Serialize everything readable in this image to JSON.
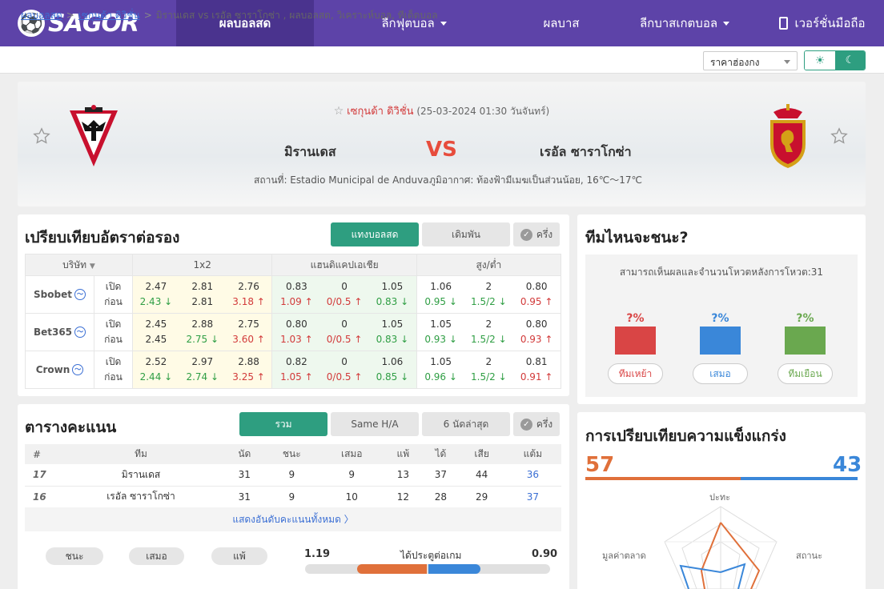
{
  "nav": {
    "logo": "SAGOR",
    "items": [
      {
        "label": "ผลบอลสด",
        "active": true
      },
      {
        "label": "ลีกฟุตบอล",
        "caret": true
      },
      {
        "label": "ผลบาส"
      },
      {
        "label": "ลีกบาสเกตบอล",
        "caret": true
      },
      {
        "label": "เวอร์ชั่นมือถือ"
      }
    ]
  },
  "breadcrumb": {
    "home": "ผลบอลสด",
    "league": "เซกุนด้า ดิวิชั่น",
    "rest": "มิรานเดส vs  เรอัล ซาราโกซ่า ,  ผลบอลสด,  วิเคราะห์บอล,  ทีเด็ดบอล"
  },
  "odds_select": "ราคาฮ่องกง",
  "match": {
    "league": "เซกุนด้า ดิวิชั่น",
    "datetime": "(25-03-2024 01:30 วันจันทร์)",
    "home": "มิรานเดส",
    "away": "เรอัล ซาราโกซ่า",
    "vs": "VS",
    "venue": "สถานที่: Estadio Municipal de Anduva",
    "weather": "ภูมิอากาศ: ท้องฟ้ามีเมฆเป็นส่วนน้อย, 16℃～17℃"
  },
  "odds": {
    "title": "เปรียบเทียบอัตราต่อรอง",
    "tabs": [
      "แทงบอลสด",
      "เดิมพัน"
    ],
    "half": "ครึ่ง",
    "head": {
      "company": "บริษัท",
      "x12": "1x2",
      "ah": "แฮนดิแคปเอเชีย",
      "ou": "สูง/ต่ำ"
    },
    "open_label": "เปิด",
    "before_label": "ก่อน",
    "rows": [
      {
        "company": "Sbobet",
        "open": [
          "2.47",
          "2.81",
          "2.76",
          "0.83",
          "0",
          "1.05",
          "1.06",
          "2",
          "0.80"
        ],
        "before": [
          "2.43 ↓",
          "2.81",
          "3.18 ↑",
          "1.09 ↑",
          "0/0.5 ↑",
          "0.83 ↓",
          "0.95 ↓",
          "1.5/2 ↓",
          "0.95 ↑"
        ],
        "dirs": [
          "dn",
          "",
          "up",
          "up",
          "up",
          "dn",
          "dn",
          "dn",
          "up"
        ]
      },
      {
        "company": "Bet365",
        "open": [
          "2.45",
          "2.88",
          "2.75",
          "0.80",
          "0",
          "1.05",
          "1.05",
          "2",
          "0.80"
        ],
        "before": [
          "2.45",
          "2.75 ↓",
          "3.60 ↑",
          "1.03 ↑",
          "0/0.5 ↑",
          "0.83 ↓",
          "0.93 ↓",
          "1.5/2 ↓",
          "0.93 ↑"
        ],
        "dirs": [
          "",
          "dn",
          "up",
          "up",
          "up",
          "dn",
          "dn",
          "dn",
          "up"
        ]
      },
      {
        "company": "Crown",
        "open": [
          "2.52",
          "2.97",
          "2.88",
          "0.82",
          "0",
          "1.06",
          "1.05",
          "2",
          "0.81"
        ],
        "before": [
          "2.44 ↓",
          "2.74 ↓",
          "3.25 ↑",
          "1.05 ↑",
          "0/0.5 ↑",
          "0.85 ↓",
          "0.96 ↓",
          "1.5/2 ↓",
          "0.91 ↑"
        ],
        "dirs": [
          "dn",
          "dn",
          "up",
          "up",
          "up",
          "dn",
          "dn",
          "dn",
          "up"
        ]
      }
    ]
  },
  "standings": {
    "title": "ตารางคะแนน",
    "tabs": [
      "รวม",
      "Same H/A",
      "6 นัดล่าสุด"
    ],
    "half": "ครึ่ง",
    "cols": [
      "#",
      "ทีม",
      "นัด",
      "ชนะ",
      "เสมอ",
      "แพ้",
      "ได้",
      "เสีย",
      "แต้ม"
    ],
    "rows": [
      [
        "17",
        "มิรานเดส",
        "31",
        "9",
        "9",
        "13",
        "37",
        "44",
        "36"
      ],
      [
        "16",
        "เรอัล ซาราโกซ่า",
        "31",
        "9",
        "10",
        "12",
        "28",
        "29",
        "37"
      ]
    ],
    "show_all": "แสดงอันดับคะแนนทั้งหมด 〉",
    "pills": [
      "ชนะ",
      "เสมอ",
      "แพ้"
    ],
    "goals_label": "ได้ประตูต่อเกม",
    "goals_home": "1.19",
    "goals_away": "0.90"
  },
  "who": {
    "title": "ทีมไหนจะชนะ?",
    "note": "สามารถเห็นผลและจำนวนโหวตหลังการโหวต:31",
    "options": [
      {
        "pct": "?%",
        "label": "ทีมเหย้า",
        "color": "#d94545"
      },
      {
        "pct": "?%",
        "label": "เสมอ",
        "color": "#3a87d9"
      },
      {
        "pct": "?%",
        "label": "ทีมเยือน",
        "color": "#6aa84f"
      }
    ]
  },
  "strength": {
    "title": "การเปรียบเทียบความแข็งแกร่ง",
    "home": "57",
    "away": "43",
    "home_share": 0.57,
    "home_color": "#e0703a",
    "away_color": "#3a87d9",
    "axes": [
      "ปะทะ",
      "สถานะ",
      "มูลค่าตลาด"
    ]
  }
}
